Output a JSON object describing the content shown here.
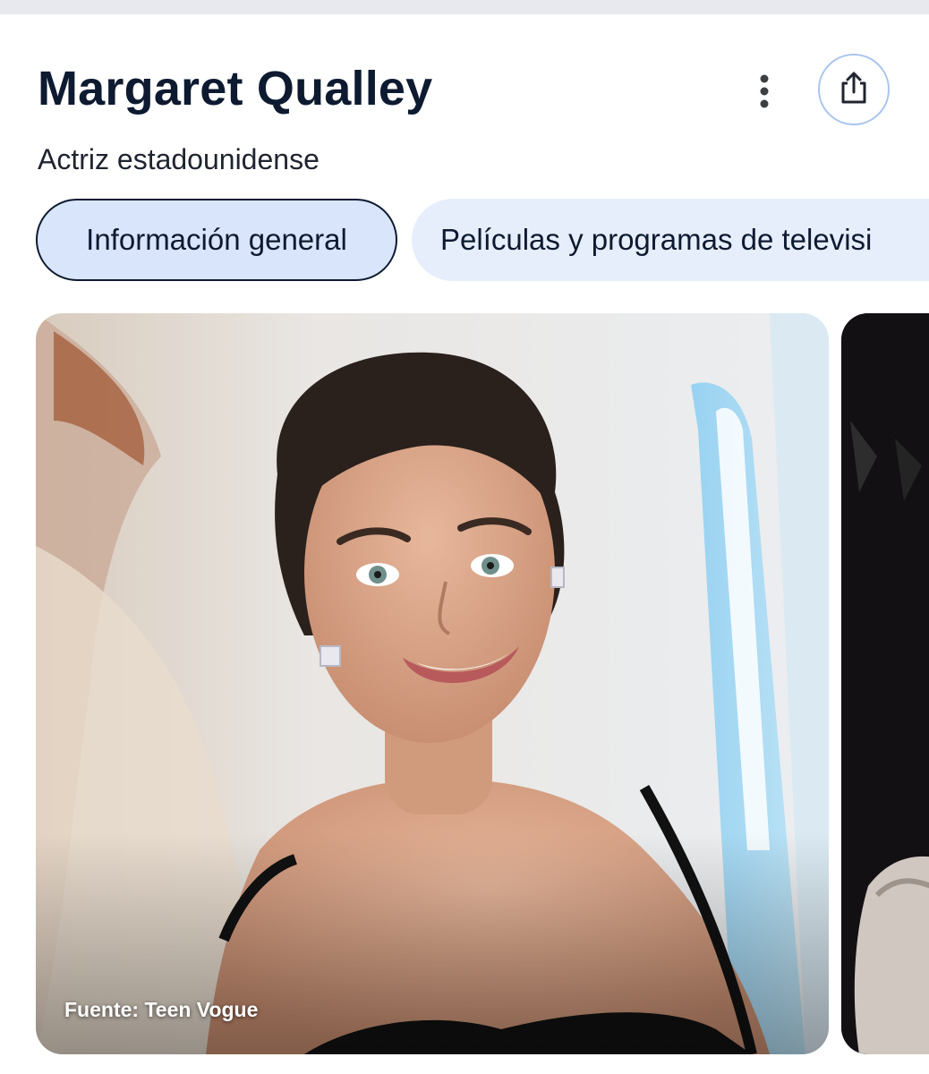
{
  "header": {
    "title": "Margaret Qualley",
    "subtitle": "Actriz estadounidense",
    "more_icon": "more-vertical-icon",
    "share_icon": "share-icon"
  },
  "tabs": [
    {
      "label": "Información general",
      "active": true
    },
    {
      "label": "Películas y programas de televisi",
      "active": false
    }
  ],
  "gallery": {
    "main_caption": "Fuente: Teen Vogue"
  },
  "colors": {
    "title": "#0d1a30",
    "tab_active_bg": "#d9e5fb",
    "tab_inactive_bg": "#e6eefc",
    "share_border": "#a9c4ee"
  }
}
